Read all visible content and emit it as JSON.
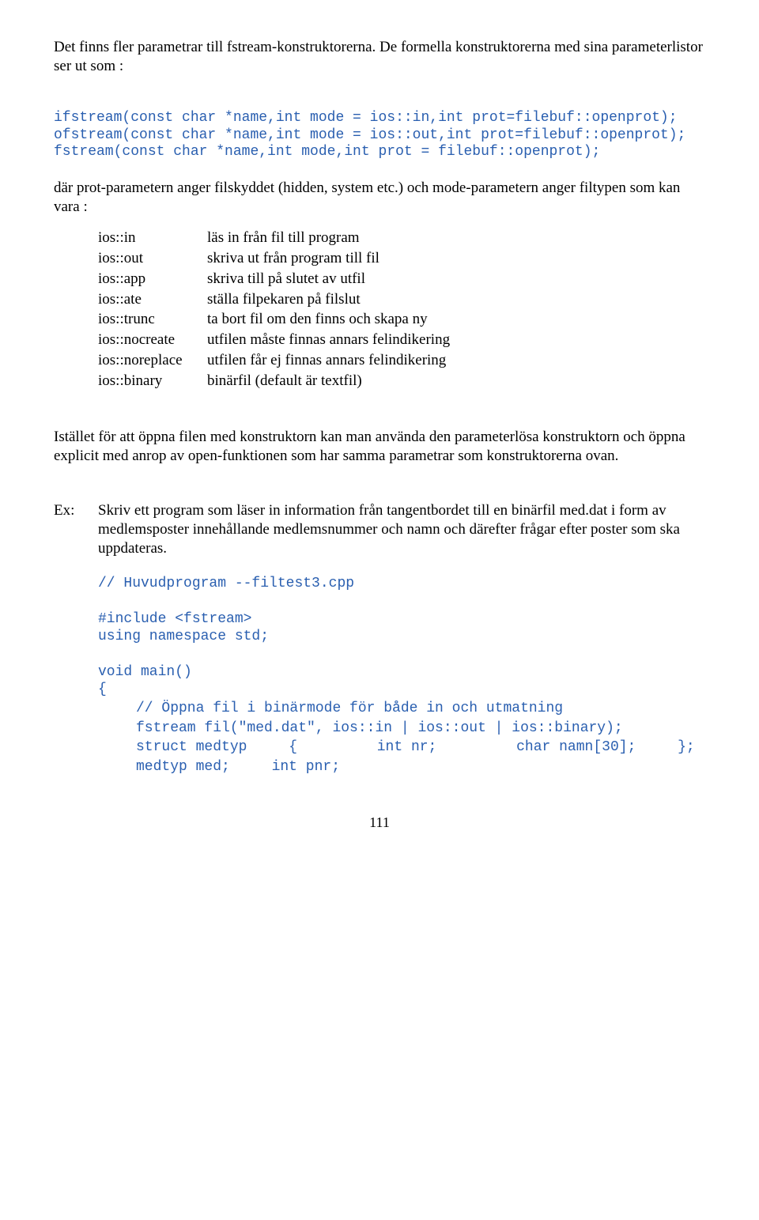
{
  "p1": "Det finns fler parametrar till fstream-konstruktorerna. De formella konstruktorerna med sina parameterlistor ser ut som :",
  "code1": {
    "l1": "ifstream(const char *name,int mode = ios::in,int prot=filebuf::openprot);",
    "l2": "ofstream(const char *name,int mode = ios::out,int prot=filebuf::openprot);",
    "l3": "fstream(const char *name,int mode,int prot = filebuf::openprot);"
  },
  "p2": "där prot-parametern anger filskyddet (hidden, system etc.) och mode-parametern anger filtypen som kan vara :",
  "modes": [
    {
      "k": "ios::in",
      "v": "läs in från fil till program"
    },
    {
      "k": "ios::out",
      "v": "skriva ut från program till fil"
    },
    {
      "k": "ios::app",
      "v": "skriva till på slutet av utfil"
    },
    {
      "k": "ios::ate",
      "v": "ställa filpekaren på filslut"
    },
    {
      "k": "ios::trunc",
      "v": "ta bort fil om den finns och skapa ny"
    },
    {
      "k": "ios::nocreate",
      "v": "utfilen måste finnas annars felindikering"
    },
    {
      "k": "ios::noreplace",
      "v": "utfilen får ej finnas annars felindikering"
    },
    {
      "k": "ios::binary",
      "v": "binärfil (default är textfil)"
    }
  ],
  "p3": "Istället för att öppna filen med konstruktorn kan man använda den parameterlösa konstruktorn och öppna explicit med anrop av open-funktionen som har samma parametrar som konstruktorerna ovan.",
  "ex_label": "Ex:",
  "ex_text": "Skriv ett program som läser in information från tangentbordet till en binärfil med.dat i form av medlemsposter innehållande medlemsnummer och namn och därefter frågar efter poster som ska uppdateras.",
  "code2": {
    "l1": "// Huvudprogram --filtest3.cpp",
    "l2": "#include <fstream>",
    "l3": "using namespace std;",
    "l4": "void main()",
    "l5": "{",
    "l6": "// Öppna fil i binärmode för både in och utmatning",
    "l7": "fstream fil(\"med.dat\", ios::in | ios::out | ios::binary);",
    "l8": "struct medtyp",
    "l9": "{",
    "l10": "int nr;",
    "l11": "char namn[30];",
    "l12": "};",
    "l13": "medtyp med;",
    "l14": "int pnr;"
  },
  "page_number": "111"
}
